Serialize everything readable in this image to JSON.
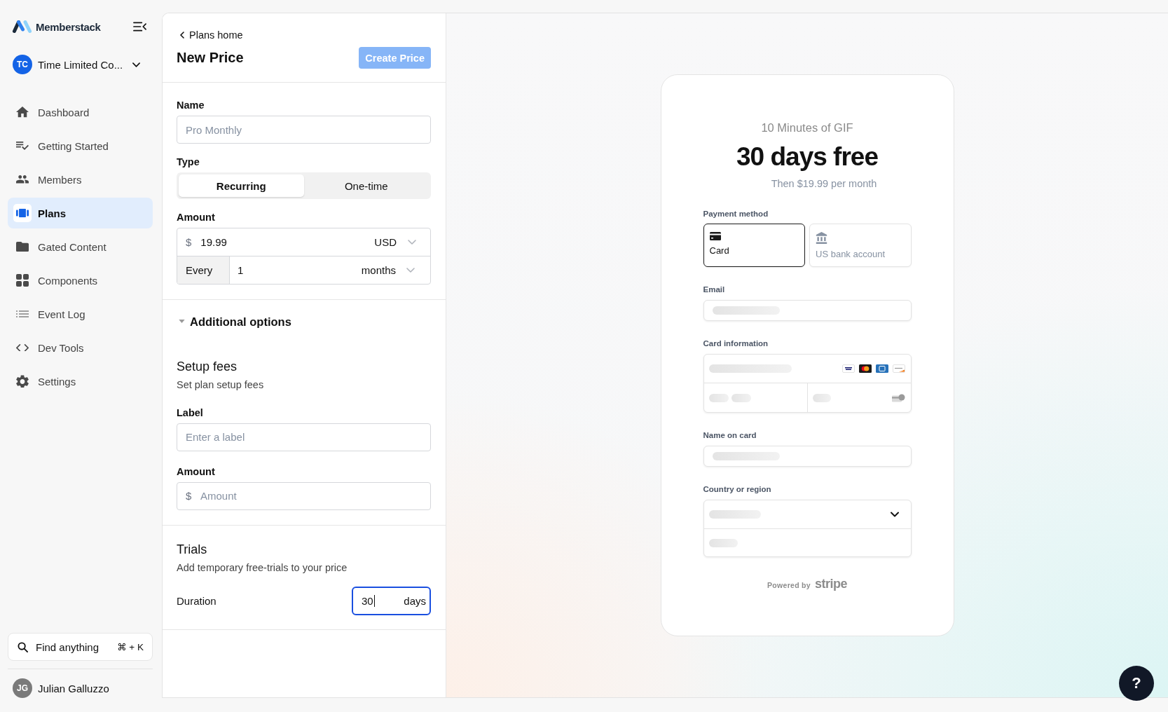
{
  "sidebar": {
    "brand": "Memberstack",
    "workspace": {
      "initials": "TC",
      "name": "Time Limited Co..."
    },
    "nav": [
      {
        "label": "Dashboard",
        "selected": false
      },
      {
        "label": "Getting Started",
        "selected": false
      },
      {
        "label": "Members",
        "selected": false
      },
      {
        "label": "Plans",
        "selected": true
      },
      {
        "label": "Gated Content",
        "selected": false
      },
      {
        "label": "Components",
        "selected": false
      },
      {
        "label": "Event Log",
        "selected": false
      },
      {
        "label": "Dev Tools",
        "selected": false
      },
      {
        "label": "Settings",
        "selected": false
      }
    ],
    "search": {
      "label": "Find anything",
      "shortcut": "⌘ + K"
    },
    "user": {
      "initials": "JG",
      "name": "Julian Galluzzo"
    }
  },
  "form": {
    "back_link": "Plans home",
    "title": "New Price",
    "create_button": {
      "label": "Create Price",
      "disabled": true
    },
    "name_field": {
      "label": "Name",
      "placeholder": "Pro Monthly"
    },
    "type": {
      "label": "Type",
      "options": [
        {
          "label": "Recurring",
          "selected": true
        },
        {
          "label": "One-time",
          "selected": false
        }
      ]
    },
    "amount": {
      "label": "Amount",
      "symbol": "$",
      "value": "19.99",
      "currency": "USD",
      "interval_prefix": "Every",
      "interval_count": "1",
      "interval_unit": "months"
    },
    "additional_options": {
      "label": "Additional options",
      "expanded": true
    },
    "setup_fees": {
      "title": "Setup fees",
      "subtitle": "Set plan setup fees",
      "label_field": {
        "label": "Label",
        "placeholder": "Enter a label"
      },
      "amount_field": {
        "label": "Amount",
        "symbol": "$",
        "placeholder": "Amount"
      }
    },
    "trials": {
      "title": "Trials",
      "subtitle": "Add temporary free-trials to your price",
      "duration": {
        "label": "Duration",
        "value": "30",
        "unit": "days",
        "focused": true
      }
    }
  },
  "preview": {
    "product": "10 Minutes of GIF",
    "headline": "30 days free",
    "subline": "Then $19.99 per month",
    "payment_method": {
      "label": "Payment method",
      "options": [
        {
          "label": "Card",
          "kind": "card",
          "selected": true
        },
        {
          "label": "US bank account",
          "kind": "bank",
          "selected": false
        }
      ]
    },
    "fields": [
      {
        "label": "Email",
        "kind": "single"
      },
      {
        "label": "Card information",
        "kind": "card"
      },
      {
        "label": "Name on card",
        "kind": "single"
      },
      {
        "label": "Country or region",
        "kind": "country"
      }
    ],
    "powered_by": "Powered by",
    "brand": "stripe"
  },
  "help_button": "?"
}
